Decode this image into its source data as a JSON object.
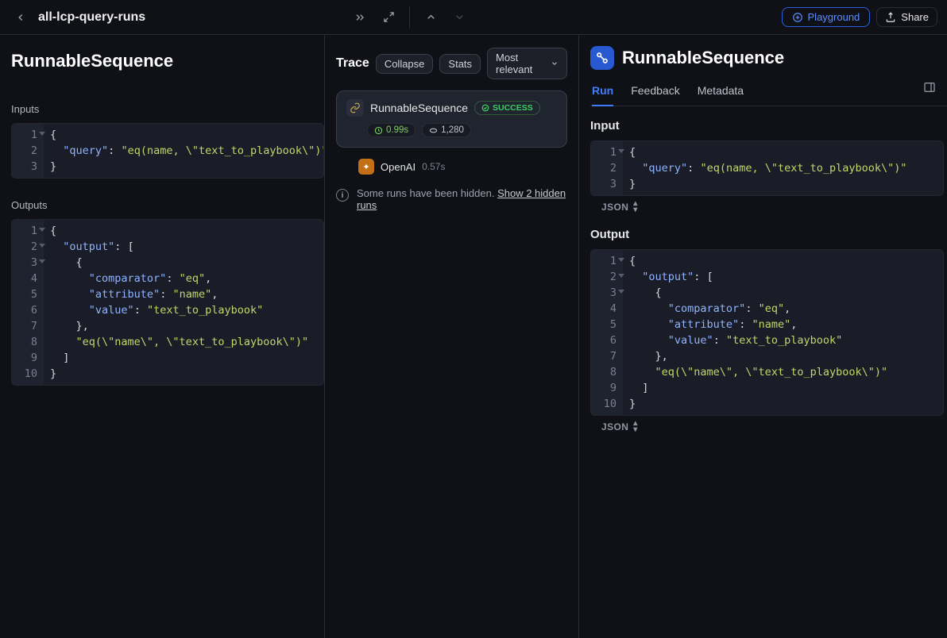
{
  "header": {
    "breadcrumb": "all-lcp-query-runs",
    "playground_label": "Playground",
    "share_label": "Share"
  },
  "left": {
    "title": "RunnableSequence",
    "inputs_label": "Inputs",
    "inputs_code": [
      {
        "n": "1",
        "fold": true,
        "html": "<span class='tok-punct'>{</span>"
      },
      {
        "n": "2",
        "html": "  <span class='tok-key'>\"query\"</span><span class='tok-punct'>:</span> <span class='tok-str'>\"eq(name, \\\"text_to_playbook\\\")\"</span>"
      },
      {
        "n": "3",
        "html": "<span class='tok-punct'>}</span>"
      }
    ],
    "outputs_label": "Outputs",
    "outputs_code": [
      {
        "n": "1",
        "fold": true,
        "html": "<span class='tok-punct'>{</span>"
      },
      {
        "n": "2",
        "fold": true,
        "html": "  <span class='tok-key'>\"output\"</span><span class='tok-punct'>:</span> <span class='tok-punct'>[</span>"
      },
      {
        "n": "3",
        "fold": true,
        "html": "    <span class='tok-punct'>{</span>"
      },
      {
        "n": "4",
        "html": "      <span class='tok-key'>\"comparator\"</span><span class='tok-punct'>:</span> <span class='tok-str'>\"eq\"</span><span class='tok-punct'>,</span>"
      },
      {
        "n": "5",
        "html": "      <span class='tok-key'>\"attribute\"</span><span class='tok-punct'>:</span> <span class='tok-str'>\"name\"</span><span class='tok-punct'>,</span>"
      },
      {
        "n": "6",
        "html": "      <span class='tok-key'>\"value\"</span><span class='tok-punct'>:</span> <span class='tok-str'>\"text_to_playbook\"</span>"
      },
      {
        "n": "7",
        "html": "    <span class='tok-punct'>},</span>"
      },
      {
        "n": "8",
        "html": "    <span class='tok-str'>\"eq(\\\"name\\\", \\\"text_to_playbook\\\")\"</span>"
      },
      {
        "n": "9",
        "html": "  <span class='tok-punct'>]</span>"
      },
      {
        "n": "10",
        "html": "<span class='tok-punct'>}</span>"
      }
    ]
  },
  "trace": {
    "title": "Trace",
    "collapse_label": "Collapse",
    "stats_label": "Stats",
    "sort_label": "Most relevant",
    "node_title": "RunnableSequence",
    "status_label": "SUCCESS",
    "duration": "0.99s",
    "tokens": "1,280",
    "child_name": "OpenAI",
    "child_time": "0.57s",
    "hidden_prefix": "Some runs have been hidden. ",
    "hidden_link": "Show 2 hidden runs"
  },
  "right": {
    "title": "RunnableSequence",
    "tabs": {
      "run": "Run",
      "feedback": "Feedback",
      "metadata": "Metadata"
    },
    "input_label": "Input",
    "output_label": "Output",
    "json_label": "JSON",
    "input_code": [
      {
        "n": "1",
        "fold": true,
        "html": "<span class='tok-punct'>{</span>"
      },
      {
        "n": "2",
        "html": "  <span class='tok-key'>\"query\"</span><span class='tok-punct'>:</span> <span class='tok-str'>\"eq(name, \\\"text_to_playbook\\\")\"</span>"
      },
      {
        "n": "3",
        "html": "<span class='tok-punct'>}</span>"
      }
    ],
    "output_code": [
      {
        "n": "1",
        "fold": true,
        "html": "<span class='tok-punct'>{</span>"
      },
      {
        "n": "2",
        "fold": true,
        "html": "  <span class='tok-key'>\"output\"</span><span class='tok-punct'>:</span> <span class='tok-punct'>[</span>"
      },
      {
        "n": "3",
        "fold": true,
        "html": "    <span class='tok-punct'>{</span>"
      },
      {
        "n": "4",
        "html": "      <span class='tok-key'>\"comparator\"</span><span class='tok-punct'>:</span> <span class='tok-str'>\"eq\"</span><span class='tok-punct'>,</span>"
      },
      {
        "n": "5",
        "html": "      <span class='tok-key'>\"attribute\"</span><span class='tok-punct'>:</span> <span class='tok-str'>\"name\"</span><span class='tok-punct'>,</span>"
      },
      {
        "n": "6",
        "html": "      <span class='tok-key'>\"value\"</span><span class='tok-punct'>:</span> <span class='tok-str'>\"text_to_playbook\"</span>"
      },
      {
        "n": "7",
        "html": "    <span class='tok-punct'>},</span>"
      },
      {
        "n": "8",
        "html": "    <span class='tok-str'>\"eq(\\\"name\\\", \\\"text_to_playbook\\\")\"</span>"
      },
      {
        "n": "9",
        "html": "  <span class='tok-punct'>]</span>"
      },
      {
        "n": "10",
        "html": "<span class='tok-punct'>}</span>"
      }
    ]
  }
}
